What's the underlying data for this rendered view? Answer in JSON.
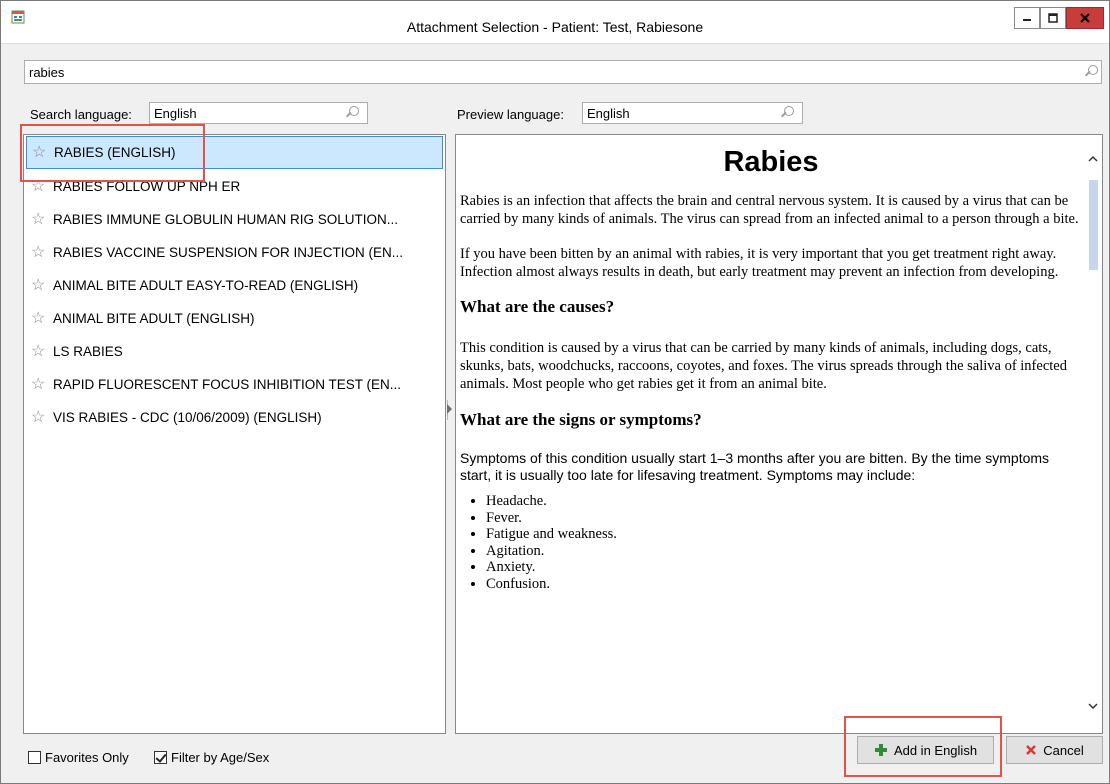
{
  "window": {
    "title": "Attachment Selection - Patient: Test, Rabiesone"
  },
  "search": {
    "value": "rabies"
  },
  "search_language": {
    "label": "Search language:",
    "value": "English"
  },
  "preview_language": {
    "label": "Preview language:",
    "value": "English"
  },
  "list": {
    "items": [
      {
        "label": "RABIES (ENGLISH)",
        "selected": true
      },
      {
        "label": "RABIES FOLLOW UP NPH ER",
        "selected": false
      },
      {
        "label": "RABIES IMMUNE GLOBULIN  HUMAN RIG SOLUTION...",
        "selected": false
      },
      {
        "label": "RABIES VACCINE SUSPENSION FOR INJECTION (EN...",
        "selected": false
      },
      {
        "label": "ANIMAL BITE  ADULT  EASY-TO-READ (ENGLISH)",
        "selected": false
      },
      {
        "label": "ANIMAL BITE  ADULT (ENGLISH)",
        "selected": false
      },
      {
        "label": "LS  RABIES",
        "selected": false
      },
      {
        "label": "RAPID FLUORESCENT FOCUS INHIBITION TEST (EN...",
        "selected": false
      },
      {
        "label": "VIS  RABIES - CDC (10/06/2009) (ENGLISH)",
        "selected": false
      }
    ]
  },
  "preview": {
    "title": "Rabies",
    "p1": "Rabies is an infection that affects the brain and central nervous system. It is caused by a virus that can be carried by many kinds of animals. The virus can spread from an infected animal to a person through a bite.",
    "p2": "If you have been bitten by an animal with rabies, it is very important that you get treatment right away. Infection almost always results in death, but early treatment may prevent an infection from developing.",
    "h_causes": "What are the causes?",
    "p3": "This condition is caused by a virus that can be carried by many kinds of animals, including dogs, cats, skunks, bats, woodchucks, raccoons, coyotes, and foxes. The virus spreads through the saliva of infected animals. Most people who get rabies get it from an animal bite.",
    "h_symptoms": "What are the signs or symptoms?",
    "p4": "Symptoms of this condition usually start 1–3 months after you are bitten. By the time symptoms start, it is usually too late for lifesaving treatment. Symptoms may include:",
    "symptoms": [
      "Headache.",
      "Fever.",
      "Fatigue and weakness.",
      "Agitation.",
      "Anxiety.",
      "Confusion."
    ]
  },
  "footer": {
    "favorites_only": {
      "label": "Favorites Only",
      "checked": false
    },
    "filter_age_sex": {
      "label": "Filter by Age/Sex",
      "checked": true
    },
    "add_button": "Add in English",
    "cancel_button": "Cancel"
  },
  "colors": {
    "selection": "#cce8ff",
    "highlight": "#e5524c",
    "close": "#c83c3c"
  }
}
